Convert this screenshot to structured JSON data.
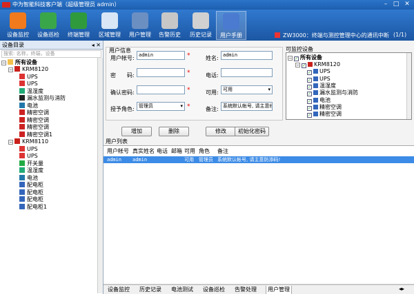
{
  "window": {
    "title": "中为智能科技客户端（超级管理员 admin）"
  },
  "toolbar": {
    "buttons": [
      {
        "label": "设备监控",
        "icon": "eye-icon",
        "color": "#f07a1c"
      },
      {
        "label": "设备巡检",
        "icon": "refresh-icon",
        "color": "#3aa64a"
      },
      {
        "label": "终端管理",
        "icon": "plus-icon",
        "color": "#2f9a3c"
      },
      {
        "label": "区域管理",
        "icon": "building-icon",
        "color": "#d8e6f5"
      },
      {
        "label": "用户管理",
        "icon": "users-icon",
        "color": "#6c8fc2"
      },
      {
        "label": "告警历史",
        "icon": "database-icon",
        "color": "#c7c7c7"
      },
      {
        "label": "历史记录",
        "icon": "database-check-icon",
        "color": "#d1d1d1"
      },
      {
        "label": "用户手册",
        "icon": "help-icon",
        "color": "#4a7bd0"
      }
    ],
    "alarm_text": "ZW3000：终端与测控管理中心的通讯中断",
    "pager": "(1/1)"
  },
  "sidebar": {
    "title": "设备目录",
    "search_placeholder": "搜索: 名称，终端，设备",
    "root": "所有设备",
    "tree": [
      {
        "label": "KRM8120",
        "level": 1,
        "icon": "server-s-icon"
      },
      {
        "label": "UPS",
        "level": 2,
        "icon": "ups-icon"
      },
      {
        "label": "UPS",
        "level": 2,
        "icon": "ups-icon"
      },
      {
        "label": "温湿度",
        "level": 2,
        "icon": "thermometer-icon"
      },
      {
        "label": "漏水监测与消防",
        "level": 2,
        "icon": "water-leak-icon"
      },
      {
        "label": "电池",
        "level": 2,
        "icon": "battery-icon"
      },
      {
        "label": "精密空调",
        "level": 2,
        "icon": "aircon-icon"
      },
      {
        "label": "精密空调",
        "level": 2,
        "icon": "aircon-icon"
      },
      {
        "label": "精密空调",
        "level": 2,
        "icon": "aircon-icon"
      },
      {
        "label": "精密空调1",
        "level": 2,
        "icon": "aircon-icon"
      },
      {
        "label": "KRM8110",
        "level": 1,
        "icon": "server-s-icon"
      },
      {
        "label": "UPS",
        "level": 2,
        "icon": "ups-icon"
      },
      {
        "label": "UPS",
        "level": 2,
        "icon": "ups-icon"
      },
      {
        "label": "开关量",
        "level": 2,
        "icon": "switch-icon"
      },
      {
        "label": "温湿度",
        "level": 2,
        "icon": "thermometer-icon"
      },
      {
        "label": "电池",
        "level": 2,
        "icon": "battery-icon"
      },
      {
        "label": "配电柜",
        "level": 2,
        "icon": "power-cabinet-icon"
      },
      {
        "label": "配电柜",
        "level": 2,
        "icon": "power-cabinet-icon"
      },
      {
        "label": "配电柜",
        "level": 2,
        "icon": "power-cabinet-icon"
      },
      {
        "label": "配电柜1",
        "level": 2,
        "icon": "power-cabinet-icon"
      }
    ]
  },
  "userinfo": {
    "title": "用户信息",
    "account_label": "用户帐号:",
    "account_value": "admin",
    "name_label": "姓名:",
    "name_value": "admin",
    "password_label": "密　　码:",
    "password_value": "",
    "phone_label": "电话:",
    "phone_value": "",
    "confirm_label": "确认密码:",
    "confirm_value": "",
    "enabled_label": "可用:",
    "enabled_value": "可用",
    "role_label": "授予角色:",
    "role_value": "管理员",
    "remark_label": "备注:",
    "remark_value": "系统默认帐号, 请主意修",
    "required_mark": "*"
  },
  "monitor": {
    "title": "可监控设备",
    "root": "所有设备",
    "items": [
      {
        "label": "KRM8120",
        "level": 1
      },
      {
        "label": "UPS",
        "level": 2
      },
      {
        "label": "UPS",
        "level": 2
      },
      {
        "label": "温湿度",
        "level": 2
      },
      {
        "label": "漏水监测与消防",
        "level": 2
      },
      {
        "label": "电池",
        "level": 2
      },
      {
        "label": "精密空调",
        "level": 2
      },
      {
        "label": "精密空调",
        "level": 2
      }
    ]
  },
  "actions": {
    "add": "增加",
    "delete": "删除",
    "edit": "修改",
    "init_password": "初始化密码"
  },
  "userlist": {
    "title": "用户列表",
    "columns": [
      "用户帐号",
      "真实姓名",
      "电话",
      "邮箱",
      "可用",
      "角色",
      "备注"
    ],
    "rows": [
      [
        "admin",
        "admin",
        "",
        "",
        "可用",
        "管理员",
        "系统默认帐号, 请主意防添码!"
      ]
    ]
  },
  "bottom_tabs": [
    "设备监控",
    "历史记录",
    "电池测试",
    "设备巡检",
    "告警处理",
    "用户管理"
  ],
  "active_tab": "用户管理"
}
